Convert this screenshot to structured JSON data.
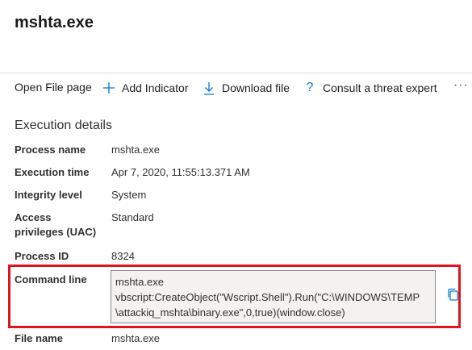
{
  "header": {
    "title": "mshta.exe"
  },
  "toolbar": {
    "open_file_page": "Open File page",
    "add_indicator": "Add Indicator",
    "download_file": "Download file",
    "consult_expert": "Consult a threat expert",
    "more": "···"
  },
  "section": {
    "title": "Execution details"
  },
  "details": {
    "process_name": {
      "label": "Process name",
      "value": "mshta.exe"
    },
    "execution_time": {
      "label": "Execution time",
      "value": "Apr 7, 2020, 11:55:13.371 AM"
    },
    "integrity_level": {
      "label": "Integrity level",
      "value": "System"
    },
    "access_privileges": {
      "label_line1": "Access",
      "label_line2": "privileges (UAC)",
      "value": "Standard"
    },
    "process_id": {
      "label": "Process ID",
      "value": "8324"
    },
    "command_line": {
      "label": "Command line",
      "lines": [
        "mshta.exe",
        "vbscript:CreateObject(\"Wscript.Shell\").Run(\"C:\\WINDOWS\\TEMP",
        "\\attackiq_mshta\\binary.exe\",0,true)(window.close)"
      ]
    },
    "file_name": {
      "label": "File name",
      "value": "mshta.exe"
    }
  },
  "colors": {
    "accent": "#0078d4",
    "highlight_border": "#e0141e"
  }
}
